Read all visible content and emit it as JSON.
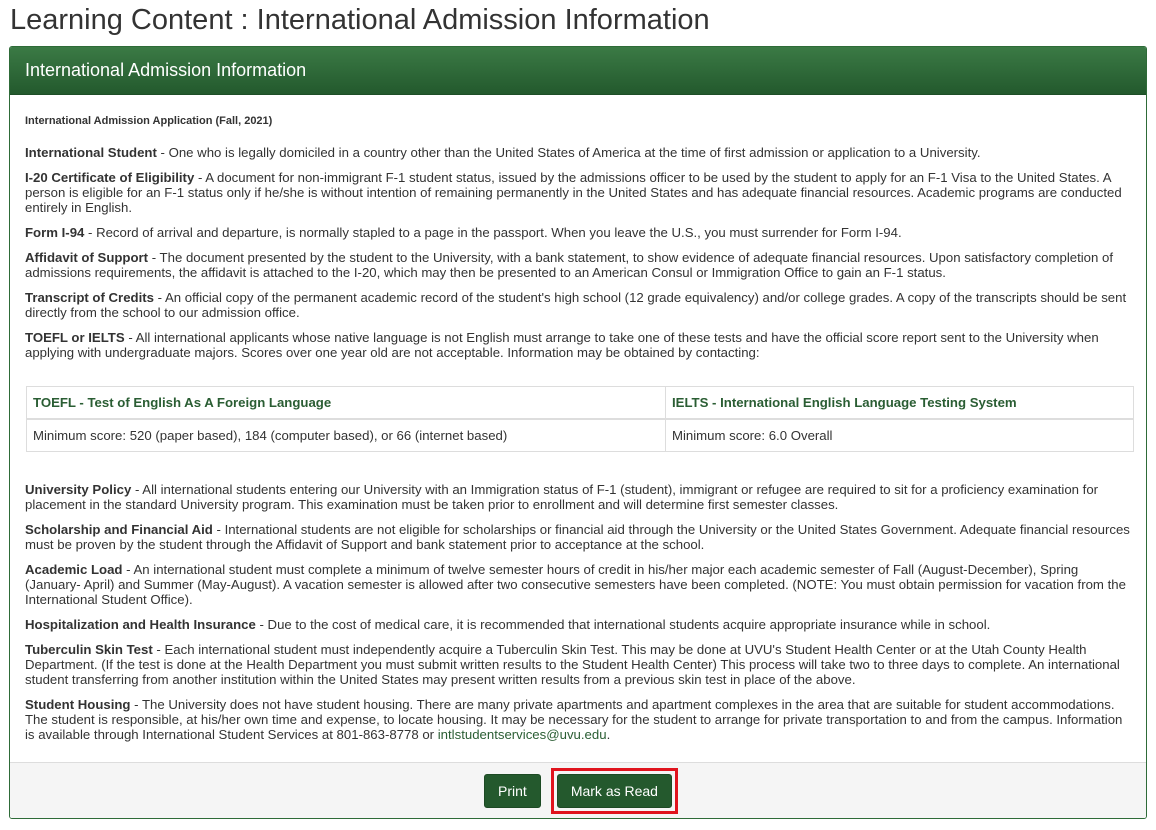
{
  "page_title": "Learning Content : International Admission Information",
  "panel": {
    "title": "International Admission Information",
    "application_heading": "International Admission Application (Fall, 2021)"
  },
  "definitions_top": [
    {
      "term": "International Student",
      "text": " - One who is legally domiciled in a country other than the United States of America at the time of first admission or application to a University."
    },
    {
      "term": "I-20 Certificate of Eligibility",
      "text": " - A document for non-immigrant F-1 student status, issued by the admissions officer to be used by the student to apply for an F-1 Visa to the United States. A person is eligible for an F-1 status only if he/she is without intention of remaining permanently in the United States and has adequate financial resources. Academic programs are conducted entirely in English."
    },
    {
      "term": "Form I-94",
      "text": " - Record of arrival and departure, is normally stapled to a page in the passport. When you leave the U.S., you must surrender for Form I-94."
    },
    {
      "term": "Affidavit of Support",
      "text": " - The document presented by the student to the University, with a bank statement, to show evidence of adequate financial resources. Upon satisfactory completion of admissions requirements, the affidavit is attached to the I-20, which may then be presented to an American Consul or Immigration Office to gain an F-1 status."
    },
    {
      "term": "Transcript of Credits",
      "text": " - An official copy of the permanent academic record of the student's high school (12 grade equivalency) and/or college grades. A copy of the transcripts should be sent directly from the school to our admission office."
    },
    {
      "term": "TOEFL or IELTS",
      "text": " - All international applicants whose native language is not English must arrange to take one of these tests and have the official score report sent to the University when applying with undergraduate majors. Scores over one year old are not acceptable. Information may be obtained by contacting:"
    }
  ],
  "scores_table": {
    "headers": [
      "TOEFL - Test of English As A Foreign Language",
      "IELTS - International English Language Testing System"
    ],
    "row": [
      "Minimum score: 520 (paper based), 184 (computer based), or 66 (internet based)",
      "Minimum score: 6.0 Overall"
    ]
  },
  "definitions_bottom": [
    {
      "term": "University Policy",
      "text": " - All international students entering our University with an Immigration status of F-1 (student), immigrant or refugee are required to sit for a proficiency examination for placement in the standard University program. This examination must be taken prior to enrollment and will determine first semester classes."
    },
    {
      "term": "Scholarship and Financial Aid",
      "text": " - International students are not eligible for scholarships or financial aid through the University or the United States Government. Adequate financial resources must be proven by the student through the Affidavit of Support and bank statement prior to acceptance at the school."
    },
    {
      "term": "Academic Load",
      "text": " - An international student must complete a minimum of twelve semester hours of credit in his/her major each academic semester of Fall (August-December), Spring (January- April) and Summer (May-August). A vacation semester is allowed after two consecutive semesters have been completed. (NOTE: You must obtain permission for vacation from the International Student Office)."
    },
    {
      "term": "Hospitalization and Health Insurance",
      "text": " - Due to the cost of medical care, it is recommended that international students acquire appropriate insurance while in school."
    },
    {
      "term": "Tuberculin Skin Test",
      "text": " - Each international student must independently acquire a Tuberculin Skin Test. This may be done at UVU's Student Health Center or at the Utah County Health Department. (If the test is done at the Health Department you must submit written results to the Student Health Center) This process will take two to three days to complete. An international student transferring from another institution within the United States may present written results from a previous skin test in place of the above."
    }
  ],
  "housing": {
    "term": "Student Housing",
    "text": " - The University does not have student housing. There are many private apartments and apartment complexes in the area that are suitable for student accommodations. The student is responsible, at his/her own time and expense, to locate housing. It may be necessary for the student to arrange for private transportation to and from the campus. Information is available through International Student Services at 801-863-8778 or ",
    "email": "intlstudentservices@uvu.edu",
    "tail": "."
  },
  "footer": {
    "print_label": "Print",
    "mark_read_label": "Mark as Read"
  },
  "colors": {
    "accent": "#24592d",
    "highlight": "#e0141e"
  }
}
